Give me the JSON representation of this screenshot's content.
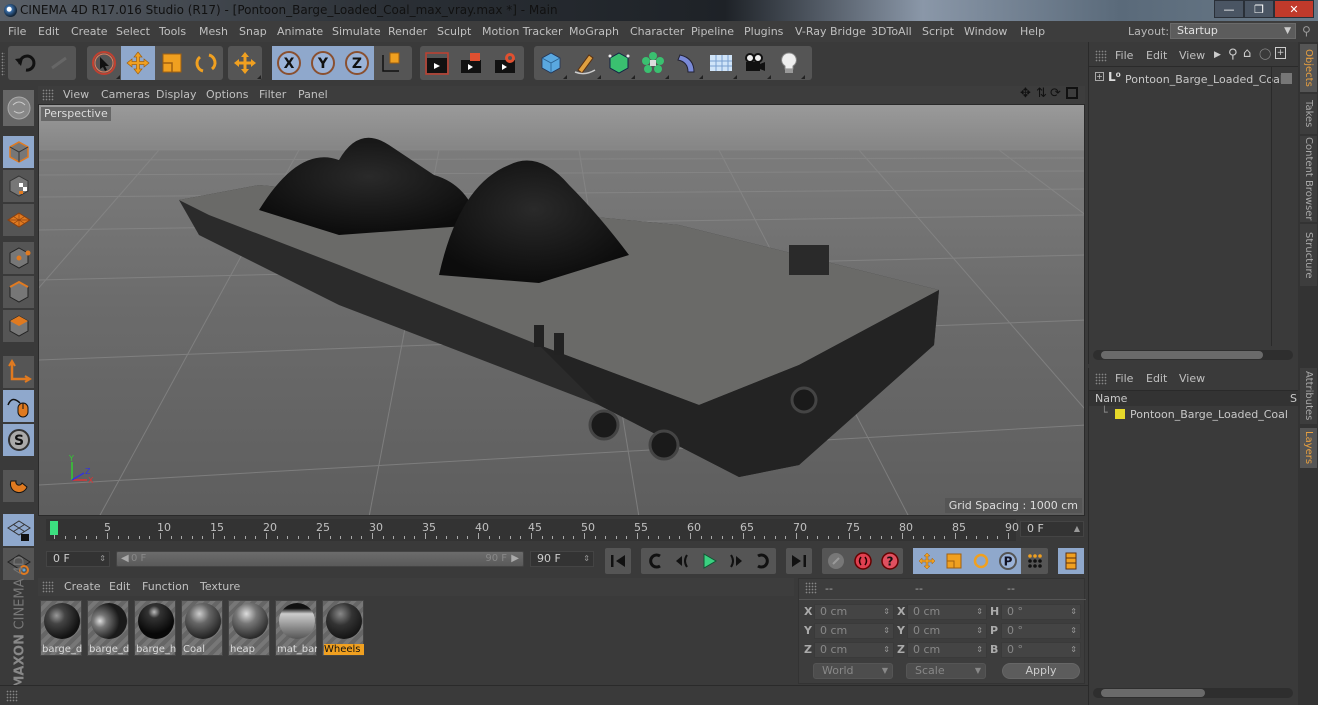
{
  "window": {
    "title": "CINEMA 4D R17.016 Studio (R17) - [Pontoon_Barge_Loaded_Coal_max_vray.max *] - Main",
    "controls": [
      "minimize",
      "restore",
      "close"
    ]
  },
  "menubar": {
    "items": [
      "File",
      "Edit",
      "Create",
      "Select",
      "Tools",
      "Mesh",
      "Snap",
      "Animate",
      "Simulate",
      "Render",
      "Sculpt",
      "Motion Tracker",
      "MoGraph",
      "Character",
      "Pipeline",
      "Plugins",
      "V-Ray Bridge",
      "3DToAll",
      "Script",
      "Window",
      "Help"
    ],
    "layout_label": "Layout:",
    "layout_value": "Startup"
  },
  "toolbar": {
    "groups": [
      [
        "undo-icon",
        "redo-icon"
      ],
      [
        "live-selection-icon",
        "move-icon",
        "scale-icon",
        "rotate-icon"
      ],
      [
        "recent-tool-icon"
      ],
      [
        "x-axis-icon",
        "y-axis-icon",
        "z-axis-icon",
        "coordinate-system-icon"
      ],
      [
        "render-view-icon",
        "render-picture-viewer-icon",
        "render-settings-icon"
      ],
      [
        "cube-icon",
        "pen-icon",
        "subdivision-icon",
        "cloner-icon",
        "deformer-icon",
        "floor-icon",
        "camera-icon",
        "light-icon"
      ]
    ]
  },
  "viewport": {
    "menu": [
      "View",
      "Cameras",
      "Display",
      "Options",
      "Filter",
      "Panel"
    ],
    "camera_label": "Perspective",
    "grid_spacing": "Grid Spacing : 1000 cm"
  },
  "left_tools": [
    "make-editable-icon",
    "texture-mode-icon",
    "workplane-mode-icon",
    "points-mode-icon",
    "edges-mode-icon",
    "polygons-mode-icon",
    "axis-mode-icon",
    "tweak-mode-icon",
    "solo-icon",
    "snap-icon",
    "workplane-lock-icon",
    "workplane-icon"
  ],
  "timeline": {
    "ticks": [
      "0",
      "5",
      "10",
      "15",
      "20",
      "25",
      "30",
      "35",
      "40",
      "45",
      "50",
      "55",
      "60",
      "65",
      "70",
      "75",
      "80",
      "85",
      "90"
    ],
    "current_frame": "0 F",
    "start_field": "0 F",
    "range_start": "0 F",
    "range_end": "90 F",
    "end_field": "90 F",
    "playhead_frame": 0,
    "max_frame": 90
  },
  "playback": {
    "buttons": [
      "go-to-start-icon",
      "previous-key-icon",
      "previous-frame-icon",
      "play-icon",
      "next-frame-icon",
      "next-key-icon",
      "go-to-end-icon"
    ],
    "record_buttons": [
      "record-disabled-icon",
      "record-active-icon",
      "autokey-icon"
    ],
    "key_buttons": [
      "key-position-icon",
      "key-scale-icon",
      "key-rotation-icon",
      "key-parameter-icon",
      "key-pla-icon",
      "timeline-icon"
    ]
  },
  "material_manager": {
    "menu": [
      "Create",
      "Edit",
      "Function",
      "Texture"
    ],
    "materials": [
      {
        "name": "barge_d",
        "selected": false
      },
      {
        "name": "barge_d",
        "selected": false
      },
      {
        "name": "barge_h",
        "selected": false
      },
      {
        "name": "Coal",
        "selected": false
      },
      {
        "name": "heap",
        "selected": false
      },
      {
        "name": "mat_bar",
        "selected": false
      },
      {
        "name": "Wheels",
        "selected": true
      }
    ],
    "logo_line1": "MAXON",
    "logo_line2": "CINEMA 4D"
  },
  "coordinates": {
    "headers": [
      "--",
      "--",
      "--"
    ],
    "rows": [
      {
        "l1": "X",
        "v1": "0 cm",
        "l2": "X",
        "v2": "0 cm",
        "l3": "H",
        "v3": "0 °"
      },
      {
        "l1": "Y",
        "v1": "0 cm",
        "l2": "Y",
        "v2": "0 cm",
        "l3": "P",
        "v3": "0 °"
      },
      {
        "l1": "Z",
        "v1": "0 cm",
        "l2": "Z",
        "v2": "0 cm",
        "l3": "B",
        "v3": "0 °"
      }
    ],
    "mode_dropdown": "World",
    "scale_dropdown": "Scale",
    "apply_label": "Apply"
  },
  "object_manager": {
    "menu": [
      "File",
      "Edit",
      "View"
    ],
    "objects": [
      {
        "name": "Pontoon_Barge_Loaded_Coal"
      }
    ]
  },
  "layer_manager": {
    "menu": [
      "File",
      "Edit",
      "View"
    ],
    "col_name": "Name",
    "col_s": "S",
    "layers": [
      {
        "name": "Pontoon_Barge_Loaded_Coal",
        "color": "#e6d82a"
      }
    ]
  },
  "side_tabs": {
    "top": [
      {
        "label": "Objects",
        "active": true
      },
      {
        "label": "Takes",
        "active": false
      },
      {
        "label": "Content Browser",
        "active": false
      },
      {
        "label": "Structure",
        "active": false
      }
    ],
    "bottom": [
      {
        "label": "Attributes",
        "active": false
      },
      {
        "label": "Layers",
        "active": true
      }
    ]
  }
}
